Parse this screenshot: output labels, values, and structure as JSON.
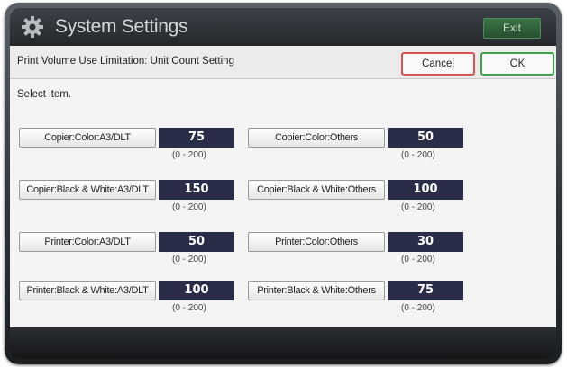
{
  "app": {
    "title": "System Settings",
    "exit_label": "Exit",
    "icon": "gear-icon"
  },
  "header": {
    "title": "Print Volume Use Limitation: Unit Count Setting",
    "cancel_label": "Cancel",
    "ok_label": "OK"
  },
  "main": {
    "prompt": "Select item.",
    "items": [
      {
        "label": "Copier:Color:A3/DLT",
        "value": "75",
        "range": "(0 - 200)"
      },
      {
        "label": "Copier:Color:Others",
        "value": "50",
        "range": "(0 - 200)"
      },
      {
        "label": "Copier:Black & White:A3/DLT",
        "value": "150",
        "range": "(0 - 200)"
      },
      {
        "label": "Copier:Black & White:Others",
        "value": "100",
        "range": "(0 - 200)"
      },
      {
        "label": "Printer:Color:A3/DLT",
        "value": "50",
        "range": "(0 - 200)"
      },
      {
        "label": "Printer:Color:Others",
        "value": "30",
        "range": "(0 - 200)"
      },
      {
        "label": "Printer:Black & White:A3/DLT",
        "value": "100",
        "range": "(0 - 200)"
      },
      {
        "label": "Printer:Black & White:Others",
        "value": "75",
        "range": "(0 - 200)"
      }
    ]
  },
  "colors": {
    "value_bg": "#2a2d47",
    "cancel_border": "#d9534f",
    "ok_border": "#3fa14a",
    "exit_bg": "#3a7446"
  }
}
